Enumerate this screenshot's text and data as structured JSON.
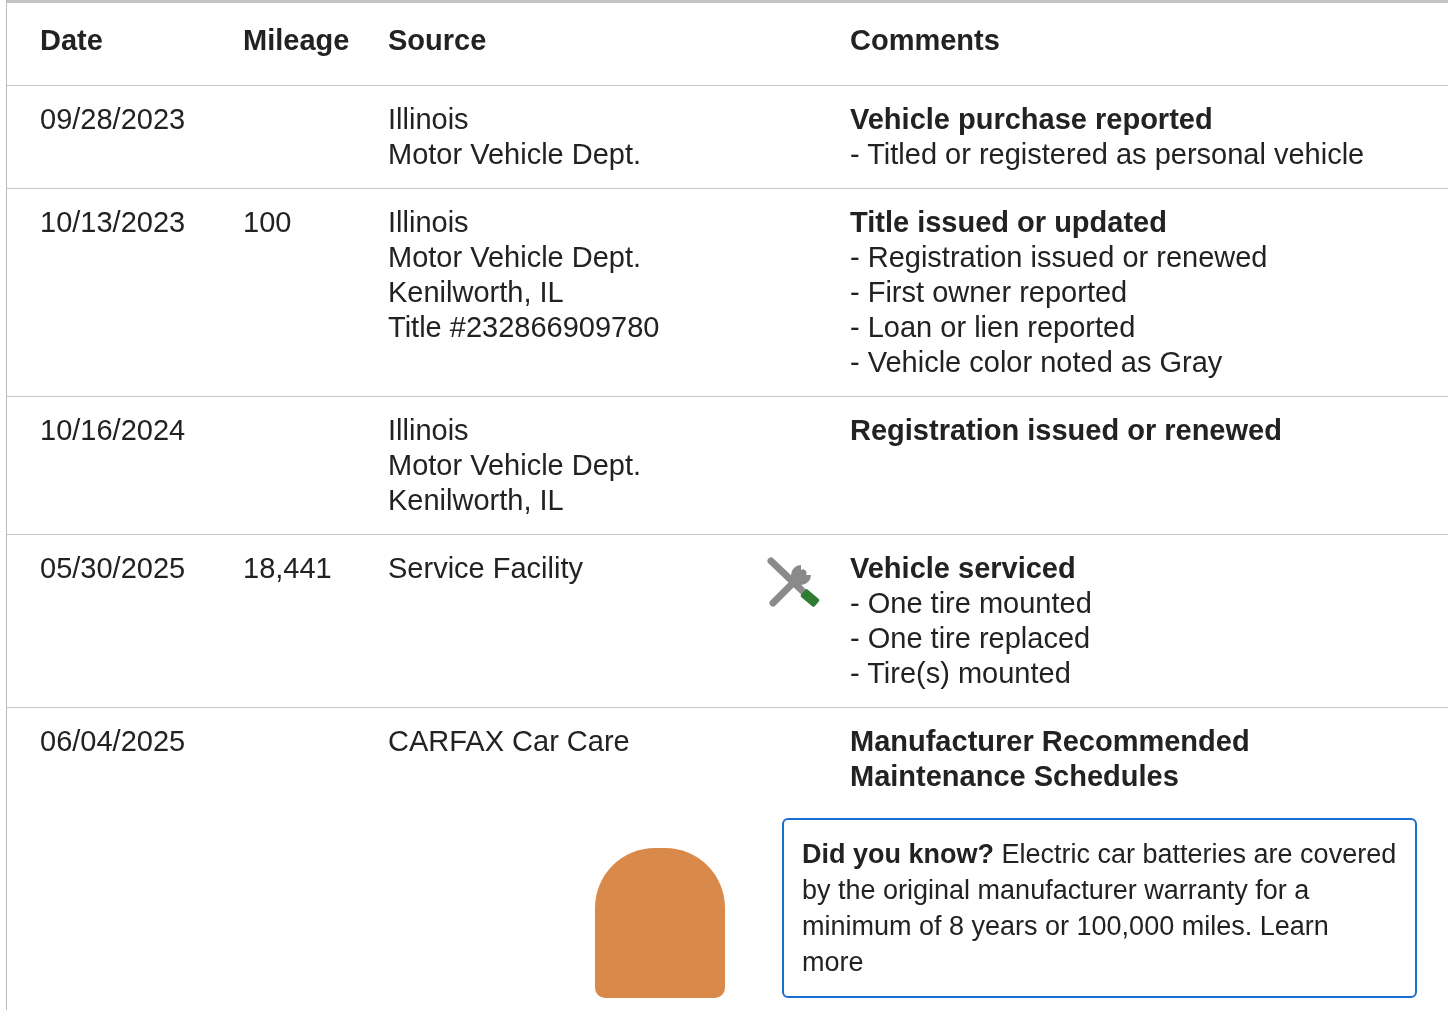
{
  "table": {
    "columns": [
      "Date",
      "Mileage",
      "Source",
      "Comments"
    ],
    "rows": [
      {
        "date": "09/28/2023",
        "mileage": "",
        "source": [
          "Illinois",
          "Motor Vehicle Dept."
        ],
        "kind": "plain",
        "title": "Vehicle purchase reported",
        "details": [
          "- Titled or registered as personal vehicle"
        ]
      },
      {
        "date": "10/13/2023",
        "mileage": "100",
        "source": [
          "Illinois",
          "Motor Vehicle Dept.",
          "Kenilworth, IL",
          "Title #232866909780"
        ],
        "kind": "plain",
        "title": "Title issued or updated",
        "details": [
          "- Registration issued or renewed",
          "- First owner reported",
          "- Loan or lien reported",
          "- Vehicle color noted as Gray"
        ]
      },
      {
        "date": "10/16/2024",
        "mileage": "",
        "source": [
          "Illinois",
          "Motor Vehicle Dept.",
          "Kenilworth, IL"
        ],
        "kind": "plain",
        "title": "Registration issued or renewed",
        "details": []
      },
      {
        "date": "05/30/2025",
        "mileage": "18,441",
        "source": [
          "Service Facility"
        ],
        "kind": "service",
        "title": "Vehicle serviced",
        "details": [
          "- One tire mounted",
          "- One tire replaced",
          "- Tire(s) mounted"
        ]
      },
      {
        "date": "06/04/2025",
        "mileage": "",
        "source": [
          "CARFAX Car Care"
        ],
        "kind": "plain",
        "title": "Manufacturer Recommended Maintenance Schedules",
        "details": [],
        "tip": "**Did you know?** Electric car batteries are covered by the original manufacturer warranty for a minimum of 8 years or 100,000 miles. Learn more"
      }
    ]
  }
}
